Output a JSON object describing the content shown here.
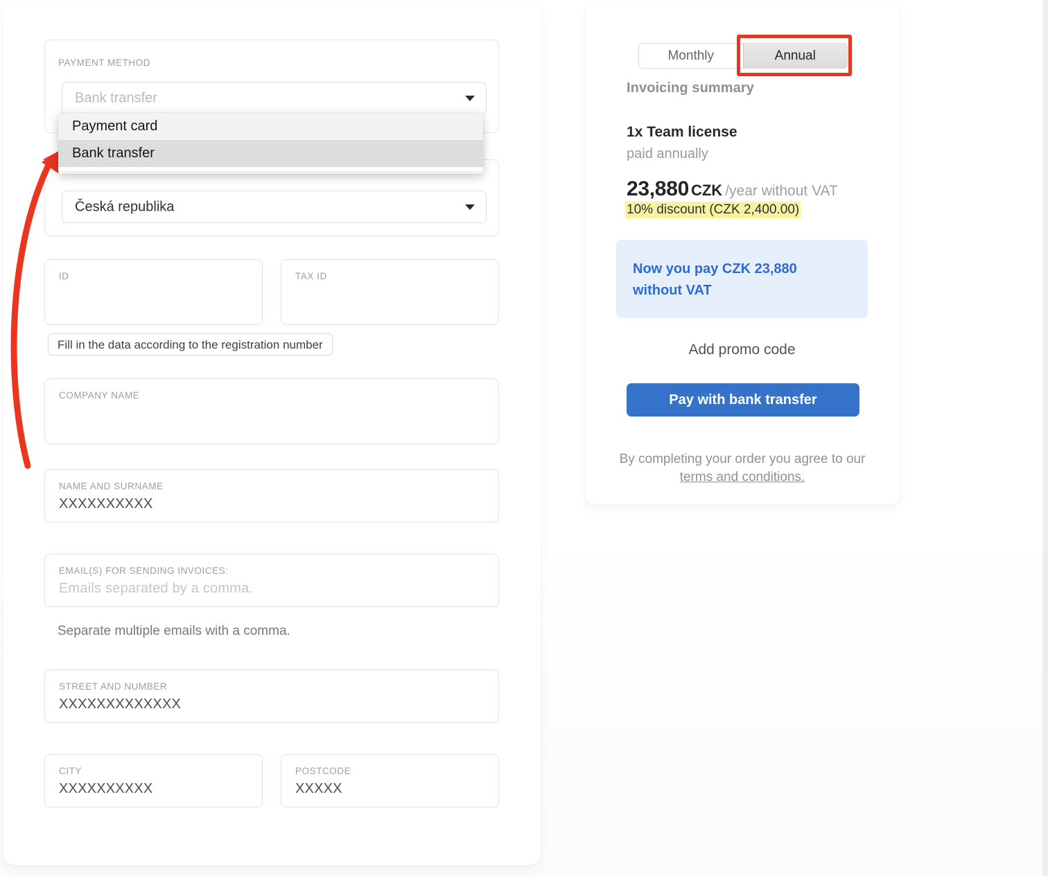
{
  "form": {
    "payment_method": {
      "label": "PAYMENT METHOD",
      "selected": "Bank transfer",
      "dropdown_open": true,
      "options": [
        "Payment card",
        "Bank transfer"
      ],
      "highlighted_option": "Bank transfer"
    },
    "country": {
      "selected": "Česká republika"
    },
    "id": {
      "label": "ID",
      "value": ""
    },
    "tax_id": {
      "label": "TAX ID",
      "value": ""
    },
    "fill_hint": "Fill in the data according to the registration number",
    "company_name": {
      "label": "COMPANY NAME",
      "value": ""
    },
    "name_and_surname": {
      "label": "NAME AND SURNAME",
      "value": "XXXXXXXXXX"
    },
    "emails": {
      "label": "EMAIL(S) FOR SENDING INVOICES:",
      "placeholder": "Emails separated by a comma.",
      "value": ""
    },
    "emails_helper": "Separate multiple emails with a comma.",
    "street": {
      "label": "STREET AND NUMBER",
      "value": "XXXXXXXXXXXXX"
    },
    "city": {
      "label": "CITY",
      "value": "XXXXXXXXXX"
    },
    "postcode": {
      "label": "POSTCODE",
      "value": "XXXXX"
    }
  },
  "summary": {
    "billing_toggle": {
      "monthly_label": "Monthly",
      "annual_label": "Annual",
      "selected": "Annual"
    },
    "title": "Invoicing summary",
    "license_line": "1x Team license",
    "paid_period": "paid annually",
    "price_amount": "23,880",
    "price_currency": "CZK",
    "price_suffix": "/year without VAT",
    "discount_badge": "10% discount (CZK 2,400.00)",
    "now_you_pay": "Now you pay CZK 23,880 without VAT",
    "add_promo_code": "Add promo code",
    "pay_button": "Pay with bank transfer",
    "terms_prefix": "By completing your order you agree to our",
    "terms_link": "terms and conditions."
  },
  "annotation": {
    "arrow_color": "#e8361f",
    "highlight_color": "#e8361f",
    "points_to": "Bank transfer"
  }
}
